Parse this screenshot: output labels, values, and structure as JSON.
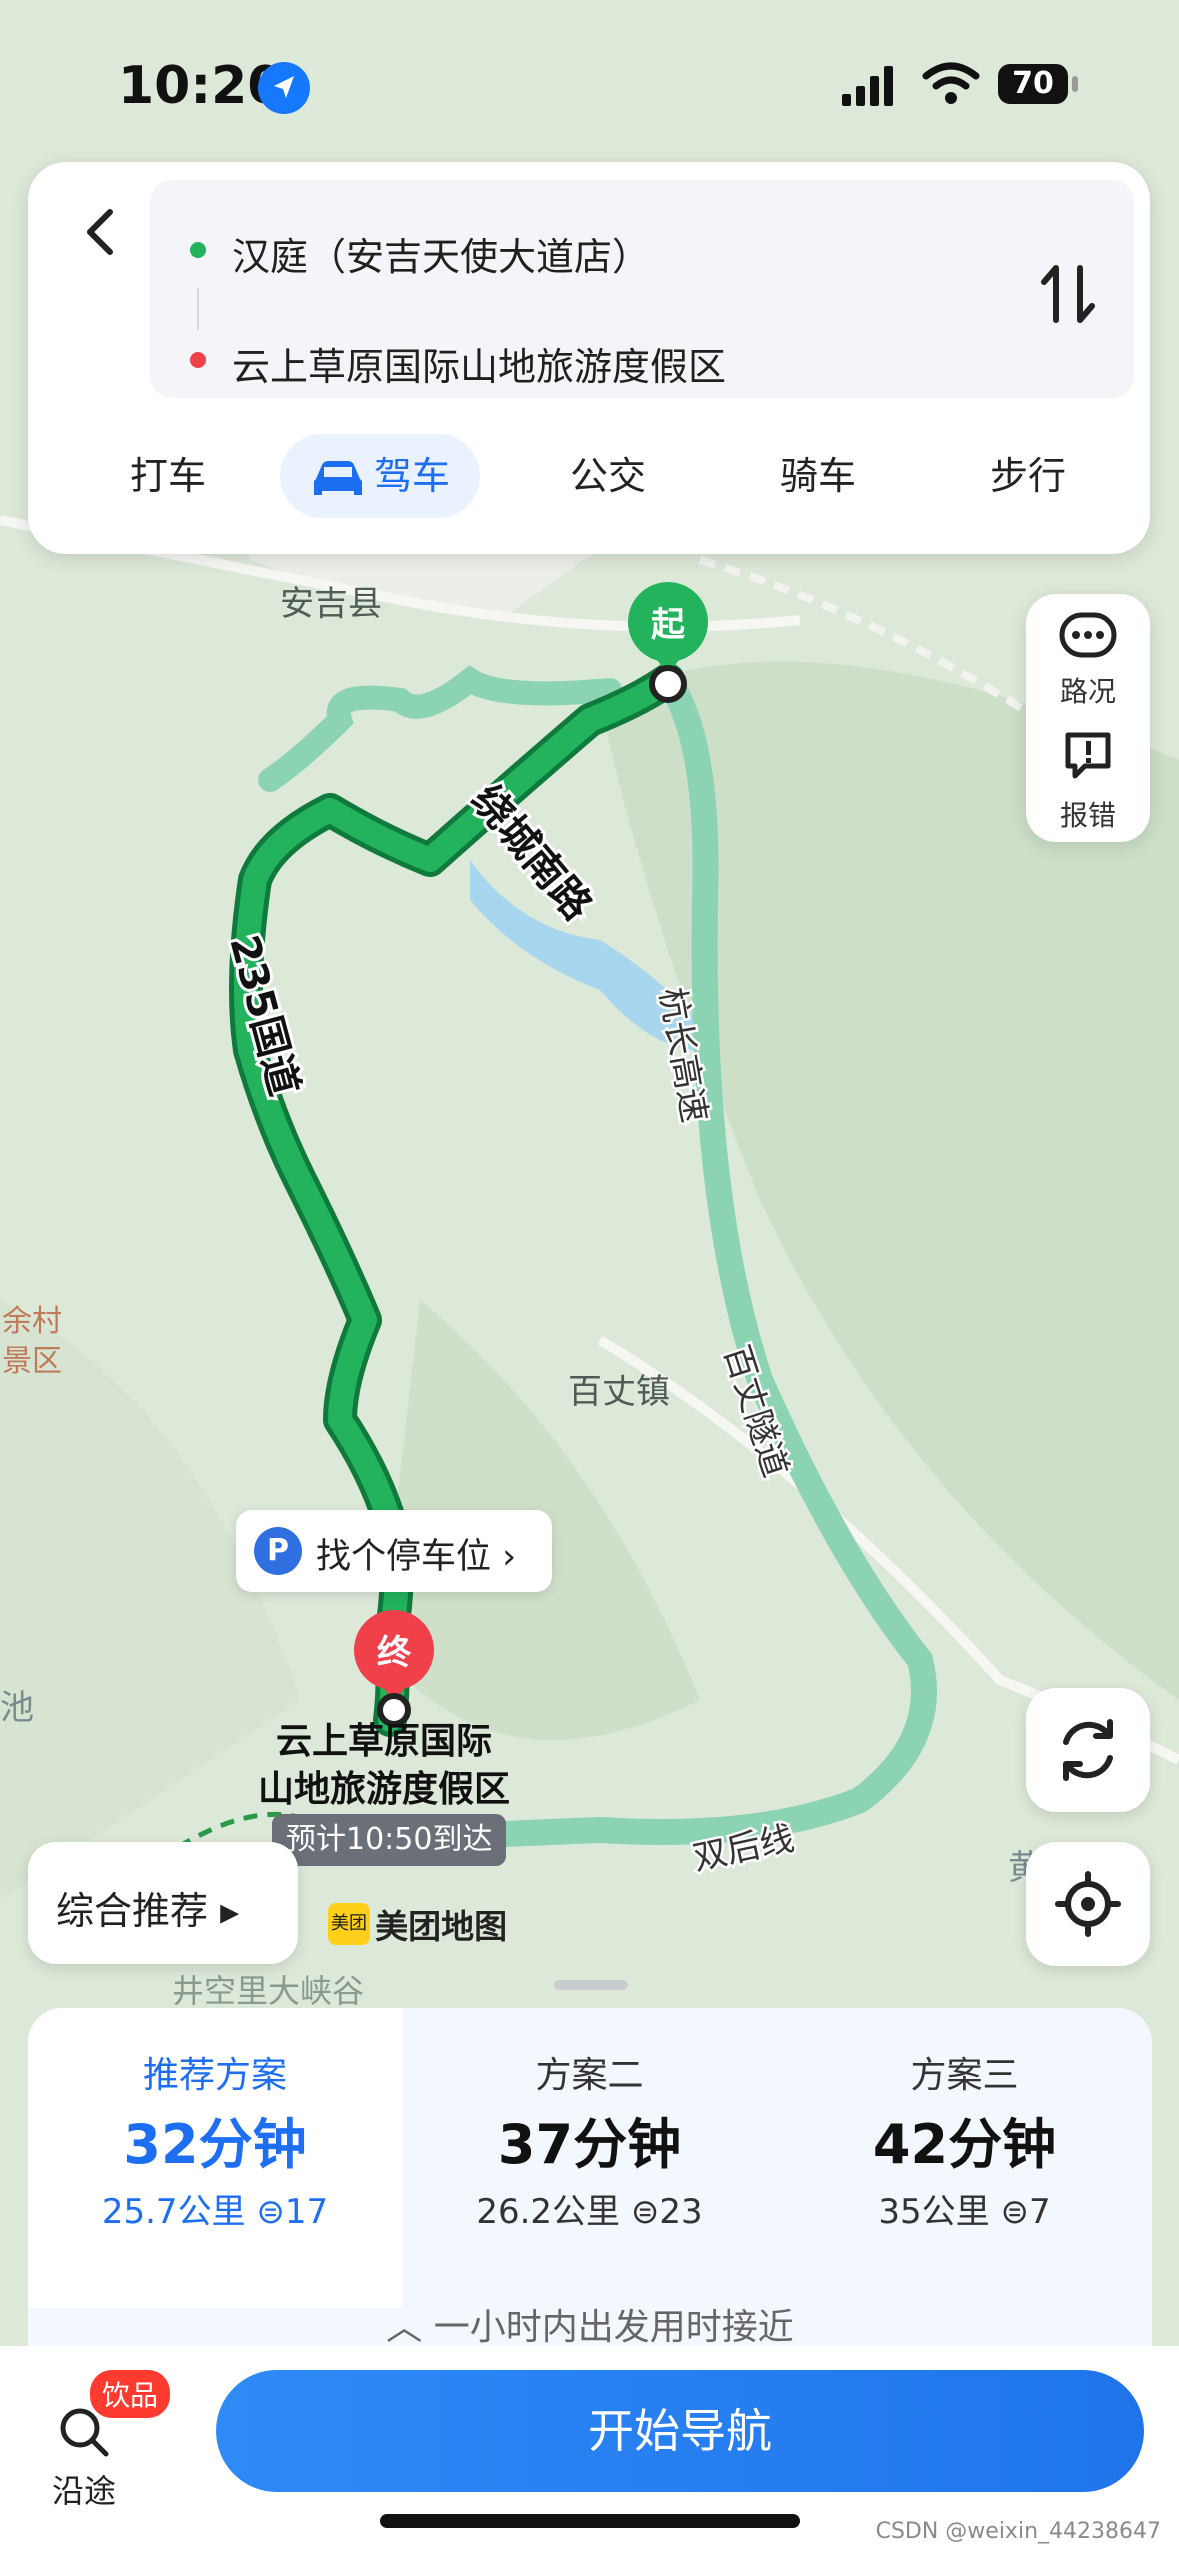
{
  "status": {
    "time": "10:20",
    "battery": "70"
  },
  "route": {
    "origin": "汉庭（安吉天使大道店）",
    "destination": "云上草原国际山地旅游度假区"
  },
  "tabs": [
    {
      "label": "打车"
    },
    {
      "label": "驾车"
    },
    {
      "label": "公交"
    },
    {
      "label": "骑车"
    },
    {
      "label": "步行"
    }
  ],
  "side": {
    "traffic": "路况",
    "report": "报错"
  },
  "map": {
    "start_marker": "起",
    "end_marker": "终",
    "places": {
      "anji": "安吉县",
      "baizhang": "百丈镇",
      "yucun": "余村",
      "yucun2": "景区",
      "chi": "池",
      "jingkong": "井空里大峡谷",
      "huang": "黄"
    },
    "roads": {
      "raocheng": "绕城南路",
      "guodao": "235国道",
      "hangchang": "杭长高速",
      "suidao": "百丈隧道",
      "shuanghou": "双后线"
    },
    "destination_label_1": "云上草原国际",
    "destination_label_2": "山地旅游度假区",
    "eta": "预计10:50到达",
    "parking": "找个停车位",
    "brand": "美团地图",
    "brand_logo": "美团"
  },
  "recommend": {
    "label": "综合推荐"
  },
  "plans": [
    {
      "name": "推荐方案",
      "minutes": "32分钟",
      "distance": "25.7公里",
      "lights": "17"
    },
    {
      "name": "方案二",
      "minutes": "37分钟",
      "distance": "26.2公里",
      "lights": "23"
    },
    {
      "name": "方案三",
      "minutes": "42分钟",
      "distance": "35公里",
      "lights": "7"
    }
  ],
  "hint": "一小时内出发用时接近",
  "bottom": {
    "along_badge": "饮品",
    "along_label": "沿途",
    "start_nav": "开始导航"
  },
  "watermark": "CSDN @weixin_44238647",
  "colors": {
    "accent": "#1e6ef2",
    "route_main": "#20b05a",
    "route_alt": "#86d1b0"
  }
}
